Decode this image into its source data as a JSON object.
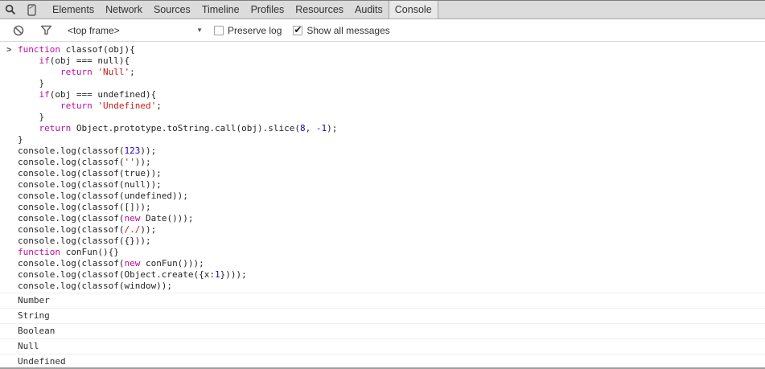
{
  "tab_bar": {
    "icons": [
      "search-icon",
      "device-icon"
    ],
    "tabs": [
      "Elements",
      "Network",
      "Sources",
      "Timeline",
      "Profiles",
      "Resources",
      "Audits",
      "Console"
    ],
    "active_tab": "Console"
  },
  "toolbar": {
    "icons": [
      "clear-console-icon",
      "filter-icon"
    ],
    "frame_selector": {
      "label": "<top frame>",
      "arrow": "▼"
    },
    "preserve_log": {
      "label": "Preserve log",
      "checked": false
    },
    "show_all_messages": {
      "label": "Show all messages",
      "checked": true
    }
  },
  "console": {
    "prompt": ">",
    "input_lines": [
      [
        {
          "c": "kw",
          "t": "function"
        },
        {
          "c": "pl",
          "t": " classof(obj){"
        }
      ],
      [
        {
          "c": "pl",
          "t": "    "
        },
        {
          "c": "kw",
          "t": "if"
        },
        {
          "c": "pl",
          "t": "(obj === null){"
        }
      ],
      [
        {
          "c": "pl",
          "t": "        "
        },
        {
          "c": "kw",
          "t": "return"
        },
        {
          "c": "pl",
          "t": " "
        },
        {
          "c": "str",
          "t": "'Null'"
        },
        {
          "c": "pl",
          "t": ";"
        }
      ],
      [
        {
          "c": "pl",
          "t": "    }"
        }
      ],
      [
        {
          "c": "pl",
          "t": "    "
        },
        {
          "c": "kw",
          "t": "if"
        },
        {
          "c": "pl",
          "t": "(obj === undefined){"
        }
      ],
      [
        {
          "c": "pl",
          "t": "        "
        },
        {
          "c": "kw",
          "t": "return"
        },
        {
          "c": "pl",
          "t": " "
        },
        {
          "c": "str",
          "t": "'Undefined'"
        },
        {
          "c": "pl",
          "t": ";"
        }
      ],
      [
        {
          "c": "pl",
          "t": "    }"
        }
      ],
      [
        {
          "c": "pl",
          "t": "    "
        },
        {
          "c": "kw",
          "t": "return"
        },
        {
          "c": "pl",
          "t": " Object.prototype.toString.call(obj).slice("
        },
        {
          "c": "num",
          "t": "8"
        },
        {
          "c": "pl",
          "t": ", "
        },
        {
          "c": "num",
          "t": "-1"
        },
        {
          "c": "pl",
          "t": ");"
        }
      ],
      [
        {
          "c": "pl",
          "t": "}"
        }
      ],
      [
        {
          "c": "pl",
          "t": "console.log(classof("
        },
        {
          "c": "num",
          "t": "123"
        },
        {
          "c": "pl",
          "t": "));"
        }
      ],
      [
        {
          "c": "pl",
          "t": "console.log(classof("
        },
        {
          "c": "str",
          "t": "''"
        },
        {
          "c": "pl",
          "t": "));"
        }
      ],
      [
        {
          "c": "pl",
          "t": "console.log(classof(true));"
        }
      ],
      [
        {
          "c": "pl",
          "t": "console.log(classof(null));"
        }
      ],
      [
        {
          "c": "pl",
          "t": "console.log(classof(undefined));"
        }
      ],
      [
        {
          "c": "pl",
          "t": "console.log(classof([]));"
        }
      ],
      [
        {
          "c": "pl",
          "t": "console.log(classof("
        },
        {
          "c": "kw",
          "t": "new"
        },
        {
          "c": "pl",
          "t": " Date()));"
        }
      ],
      [
        {
          "c": "pl",
          "t": "console.log(classof("
        },
        {
          "c": "str",
          "t": "/./"
        },
        {
          "c": "pl",
          "t": "));"
        }
      ],
      [
        {
          "c": "pl",
          "t": "console.log(classof({}));"
        }
      ],
      [
        {
          "c": "kw",
          "t": "function"
        },
        {
          "c": "pl",
          "t": " conFun(){}"
        }
      ],
      [
        {
          "c": "pl",
          "t": "console.log(classof("
        },
        {
          "c": "kw",
          "t": "new"
        },
        {
          "c": "pl",
          "t": " conFun()));"
        }
      ],
      [
        {
          "c": "pl",
          "t": "console.log(classof(Object.create({x:"
        },
        {
          "c": "num",
          "t": "1"
        },
        {
          "c": "pl",
          "t": "})));"
        }
      ],
      [
        {
          "c": "pl",
          "t": "console.log(classof(window));"
        }
      ]
    ],
    "outputs": [
      "Number",
      "String",
      "Boolean",
      "Null",
      "Undefined"
    ]
  },
  "colors": {
    "keyword": "#bf0c9c",
    "string": "#c41a16",
    "number": "#1c00cf",
    "plain_text": "#242424",
    "tab_bar_bg": "#dcdcdc",
    "active_tab_bg": "#e9e9e9",
    "row_border": "#f0f0f0",
    "toolbar_border": "#dadada"
  }
}
